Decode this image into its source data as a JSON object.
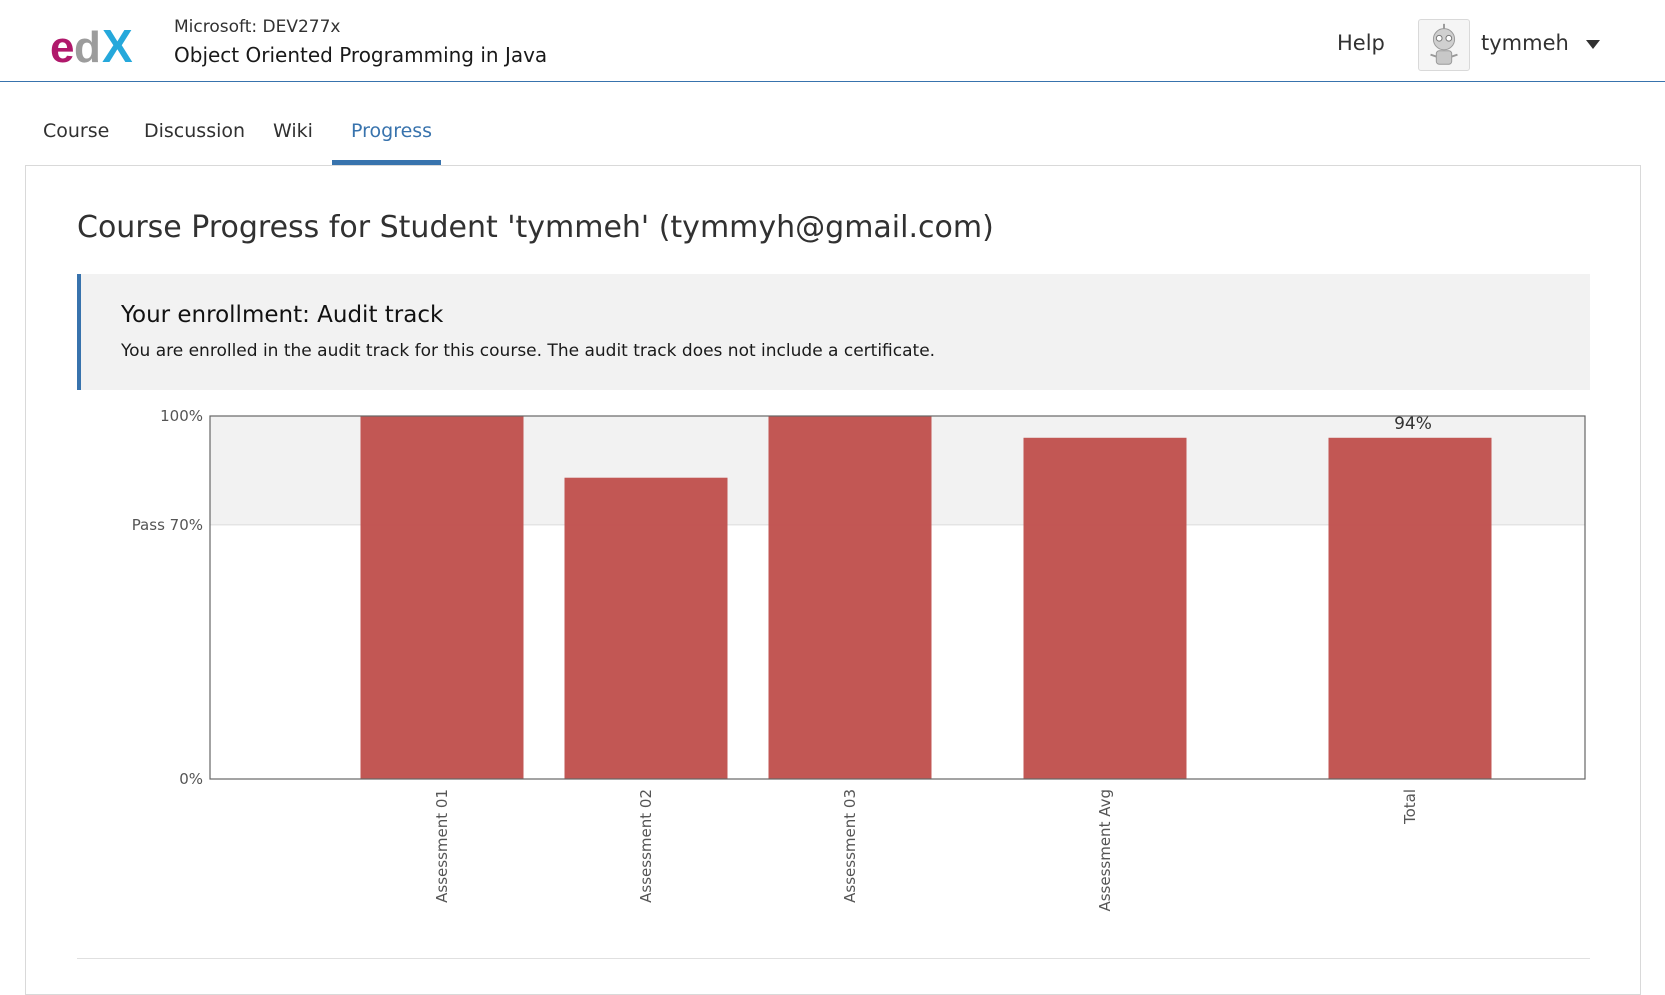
{
  "header": {
    "course_org": "Microsoft: DEV277x",
    "course_title": "Object Oriented Programming in Java",
    "help_label": "Help",
    "username": "tymmeh"
  },
  "tabs": [
    {
      "label": "Course",
      "active": false
    },
    {
      "label": "Discussion",
      "active": false
    },
    {
      "label": "Wiki",
      "active": false
    },
    {
      "label": "Progress",
      "active": true
    }
  ],
  "page": {
    "title": "Course Progress for Student 'tymmeh' (tymmyh@gmail.com)"
  },
  "notice": {
    "title": "Your enrollment: Audit track",
    "text": "You are enrolled in the audit track for this course. The audit track does not include a certificate."
  },
  "colors": {
    "accent": "#3873ad",
    "bar": "#c0504d",
    "pass_band": "#f2f2f2"
  },
  "chart_data": {
    "type": "bar",
    "categories": [
      "Assessment 01",
      "Assessment 02",
      "Assessment 03",
      "Assessment Avg",
      "Total"
    ],
    "values": [
      100,
      83,
      100,
      94,
      94
    ],
    "ytick_labels": [
      "100%",
      "Pass 70%",
      "0%"
    ],
    "ytick_values": [
      100,
      70,
      0
    ],
    "pass_threshold": 70,
    "data_labels": [
      {
        "category": "Total",
        "text": "94%"
      }
    ],
    "ylim": [
      0,
      100
    ],
    "grid": false
  }
}
